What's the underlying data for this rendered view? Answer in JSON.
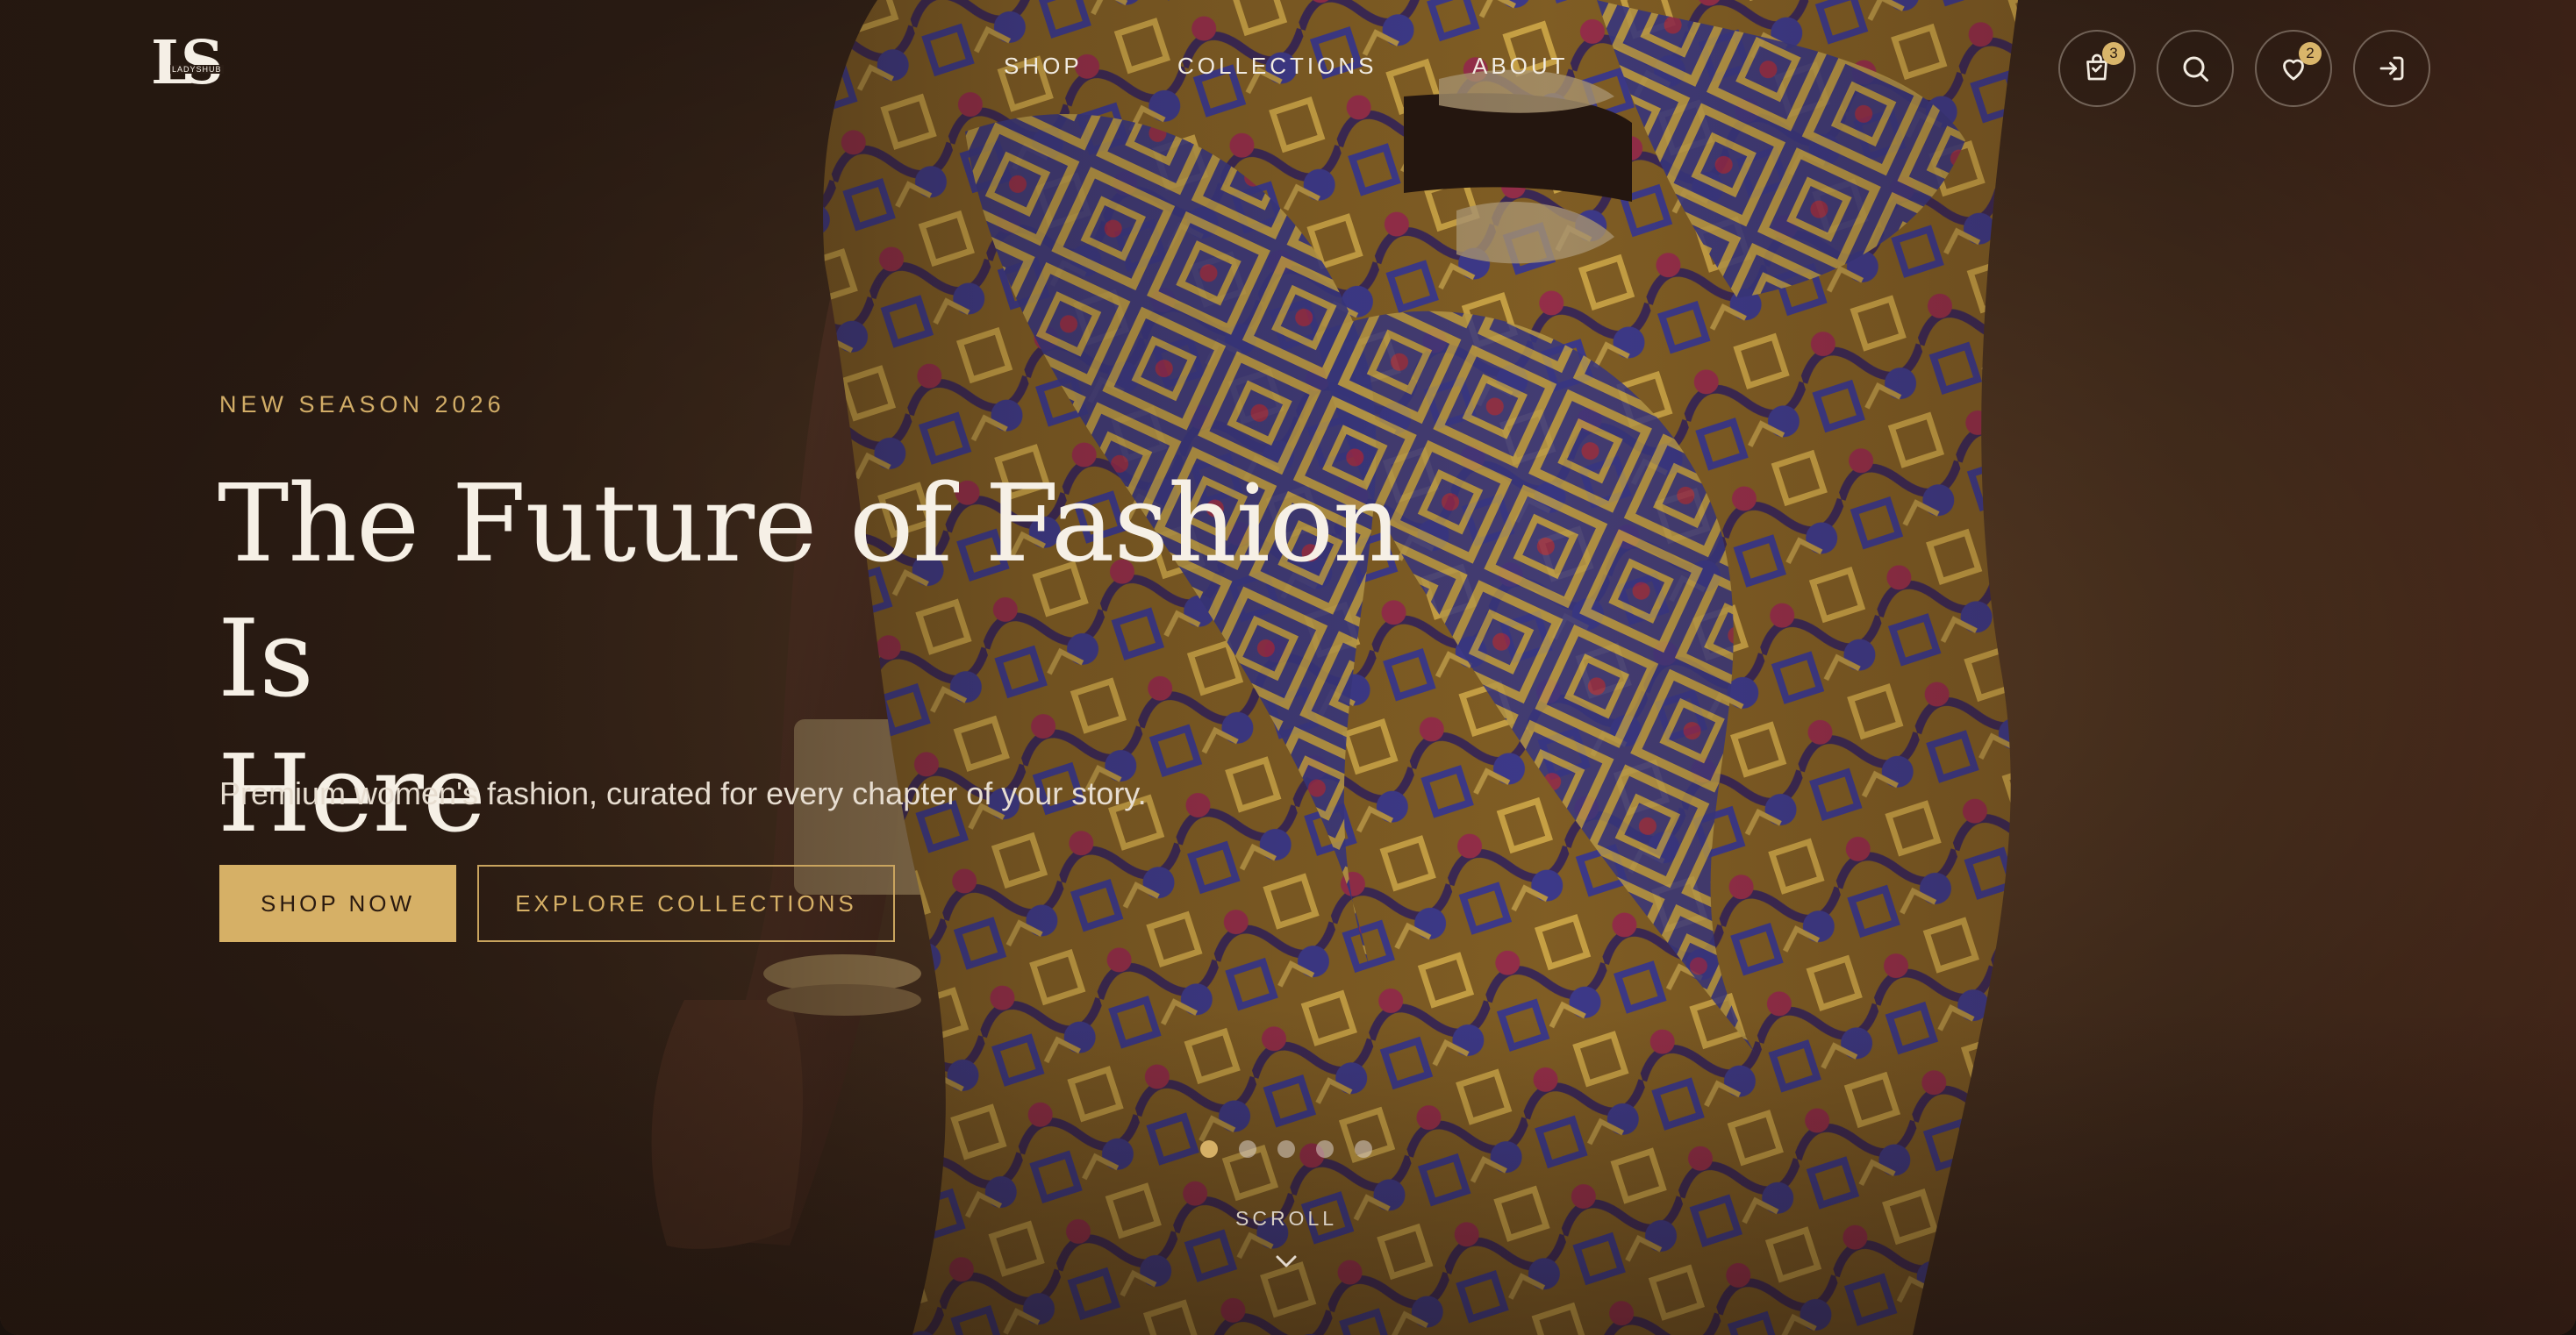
{
  "brand": {
    "logo_mark": "LS",
    "logo_word": "LADYSHUB"
  },
  "nav": {
    "items": [
      "SHOP",
      "COLLECTIONS",
      "ABOUT"
    ]
  },
  "header_actions": {
    "cart": {
      "icon": "shopping-bag-icon",
      "count": "3"
    },
    "search": {
      "icon": "search-icon"
    },
    "wishlist": {
      "icon": "heart-icon",
      "count": "2"
    },
    "login": {
      "icon": "sign-in-icon"
    }
  },
  "hero": {
    "eyebrow": "NEW SEASON 2026",
    "headline_line1": "The Future of Fashion Is",
    "headline_line2": "Here",
    "subtitle": "Premium women's fashion, curated for every chapter of your story.",
    "primary_cta": "SHOP NOW",
    "secondary_cta": "EXPLORE COLLECTIONS"
  },
  "carousel": {
    "slide_count": 5,
    "active_index": 0
  },
  "scroll_hint": {
    "label": "SCROLL",
    "icon": "chevron-down-icon"
  },
  "colors": {
    "accent_gold": "#d6b066",
    "text_light": "#f6f0e6",
    "background_dark": "#3a271c"
  }
}
